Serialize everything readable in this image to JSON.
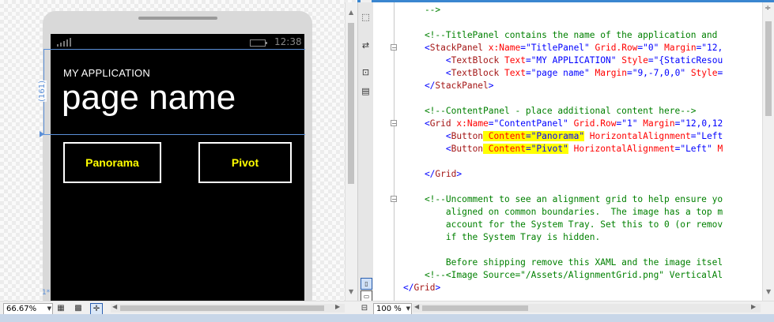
{
  "designer": {
    "phone": {
      "clock": "12:38",
      "app_title": "MY APPLICATION",
      "page_name": "page name",
      "buttons": {
        "panorama": "Panorama",
        "pivot": "Pivot"
      }
    },
    "measure_label": "(161)",
    "star_label": "1*"
  },
  "editor": {
    "lines": [
      {
        "parts": [
          [
            "com",
            "    -->"
          ]
        ]
      },
      {
        "parts": [
          [
            "com",
            ""
          ]
        ]
      },
      {
        "parts": [
          [
            "com",
            "    <!--TitlePanel contains the name of the application and"
          ]
        ]
      },
      {
        "parts": [
          [
            "pun",
            "    <"
          ],
          [
            "tag",
            "StackPanel"
          ],
          [
            "attr",
            " x:Name"
          ],
          [
            "pun",
            "=\""
          ],
          [
            "val",
            "TitlePanel"
          ],
          [
            "pun",
            "\""
          ],
          [
            "attr",
            " Grid.Row"
          ],
          [
            "pun",
            "=\""
          ],
          [
            "val",
            "0"
          ],
          [
            "pun",
            "\""
          ],
          [
            "attr",
            " Margin"
          ],
          [
            "pun",
            "=\""
          ],
          [
            "val",
            "12,"
          ]
        ]
      },
      {
        "parts": [
          [
            "pun",
            "        <"
          ],
          [
            "tag",
            "TextBlock"
          ],
          [
            "attr",
            " Text"
          ],
          [
            "pun",
            "=\""
          ],
          [
            "val",
            "MY APPLICATION"
          ],
          [
            "pun",
            "\""
          ],
          [
            "attr",
            " Style"
          ],
          [
            "pun",
            "=\""
          ],
          [
            "val",
            "{StaticResou"
          ]
        ]
      },
      {
        "parts": [
          [
            "pun",
            "        <"
          ],
          [
            "tag",
            "TextBlock"
          ],
          [
            "attr",
            " Text"
          ],
          [
            "pun",
            "=\""
          ],
          [
            "val",
            "page name"
          ],
          [
            "pun",
            "\""
          ],
          [
            "attr",
            " Margin"
          ],
          [
            "pun",
            "=\""
          ],
          [
            "val",
            "9,-7,0,0"
          ],
          [
            "pun",
            "\""
          ],
          [
            "attr",
            " Style"
          ],
          [
            "pun",
            "="
          ]
        ]
      },
      {
        "parts": [
          [
            "pun",
            "    </"
          ],
          [
            "tag",
            "StackPanel"
          ],
          [
            "pun",
            ">"
          ]
        ]
      },
      {
        "parts": [
          [
            "com",
            ""
          ]
        ]
      },
      {
        "parts": [
          [
            "com",
            "    <!--ContentPanel - place additional content here-->"
          ]
        ]
      },
      {
        "parts": [
          [
            "pun",
            "    <"
          ],
          [
            "tag",
            "Grid"
          ],
          [
            "attr",
            " x:Name"
          ],
          [
            "pun",
            "=\""
          ],
          [
            "val",
            "ContentPanel"
          ],
          [
            "pun",
            "\""
          ],
          [
            "attr",
            " Grid.Row"
          ],
          [
            "pun",
            "=\""
          ],
          [
            "val",
            "1"
          ],
          [
            "pun",
            "\""
          ],
          [
            "attr",
            " Margin"
          ],
          [
            "pun",
            "=\""
          ],
          [
            "val",
            "12,0,12"
          ]
        ]
      },
      {
        "parts": [
          [
            "pun",
            "        <"
          ],
          [
            "tag",
            "Button"
          ],
          [
            "hlattr",
            " Content"
          ],
          [
            "hlpun",
            "=\""
          ],
          [
            "hlval",
            "Panorama"
          ],
          [
            "hlpun",
            "\""
          ],
          [
            "attr",
            " HorizontalAlignment"
          ],
          [
            "pun",
            "=\""
          ],
          [
            "val",
            "Left"
          ]
        ]
      },
      {
        "parts": [
          [
            "pun",
            "        <"
          ],
          [
            "tag",
            "Button"
          ],
          [
            "hlattr",
            " Content"
          ],
          [
            "hlpun",
            "=\""
          ],
          [
            "hlval",
            "Pivot"
          ],
          [
            "hlpun",
            "\""
          ],
          [
            "attr",
            " HorizontalAlignment"
          ],
          [
            "pun",
            "=\""
          ],
          [
            "val",
            "Left"
          ],
          [
            "pun",
            "\""
          ],
          [
            "attr",
            " M"
          ]
        ]
      },
      {
        "parts": [
          [
            "com",
            ""
          ]
        ]
      },
      {
        "parts": [
          [
            "pun",
            "    </"
          ],
          [
            "tag",
            "Grid"
          ],
          [
            "pun",
            ">"
          ]
        ]
      },
      {
        "parts": [
          [
            "com",
            ""
          ]
        ]
      },
      {
        "parts": [
          [
            "com",
            "    <!--Uncomment to see an alignment grid to help ensure yo"
          ]
        ]
      },
      {
        "parts": [
          [
            "com",
            "        aligned on common boundaries.  The image has a top m"
          ]
        ]
      },
      {
        "parts": [
          [
            "com",
            "        account for the System Tray. Set this to 0 (or remov"
          ]
        ]
      },
      {
        "parts": [
          [
            "com",
            "        if the System Tray is hidden."
          ]
        ]
      },
      {
        "parts": [
          [
            "com",
            ""
          ]
        ]
      },
      {
        "parts": [
          [
            "com",
            "        Before shipping remove this XAML and the image itsel"
          ]
        ]
      },
      {
        "parts": [
          [
            "com",
            "    <!--<Image Source=\"/Assets/AlignmentGrid.png\" VerticalAl"
          ]
        ]
      },
      {
        "parts": [
          [
            "pun",
            "</"
          ],
          [
            "tag",
            "Grid"
          ],
          [
            "pun",
            ">"
          ]
        ]
      }
    ]
  },
  "bottombar": {
    "designer_zoom": "66.67%",
    "editor_zoom": "100 %"
  }
}
